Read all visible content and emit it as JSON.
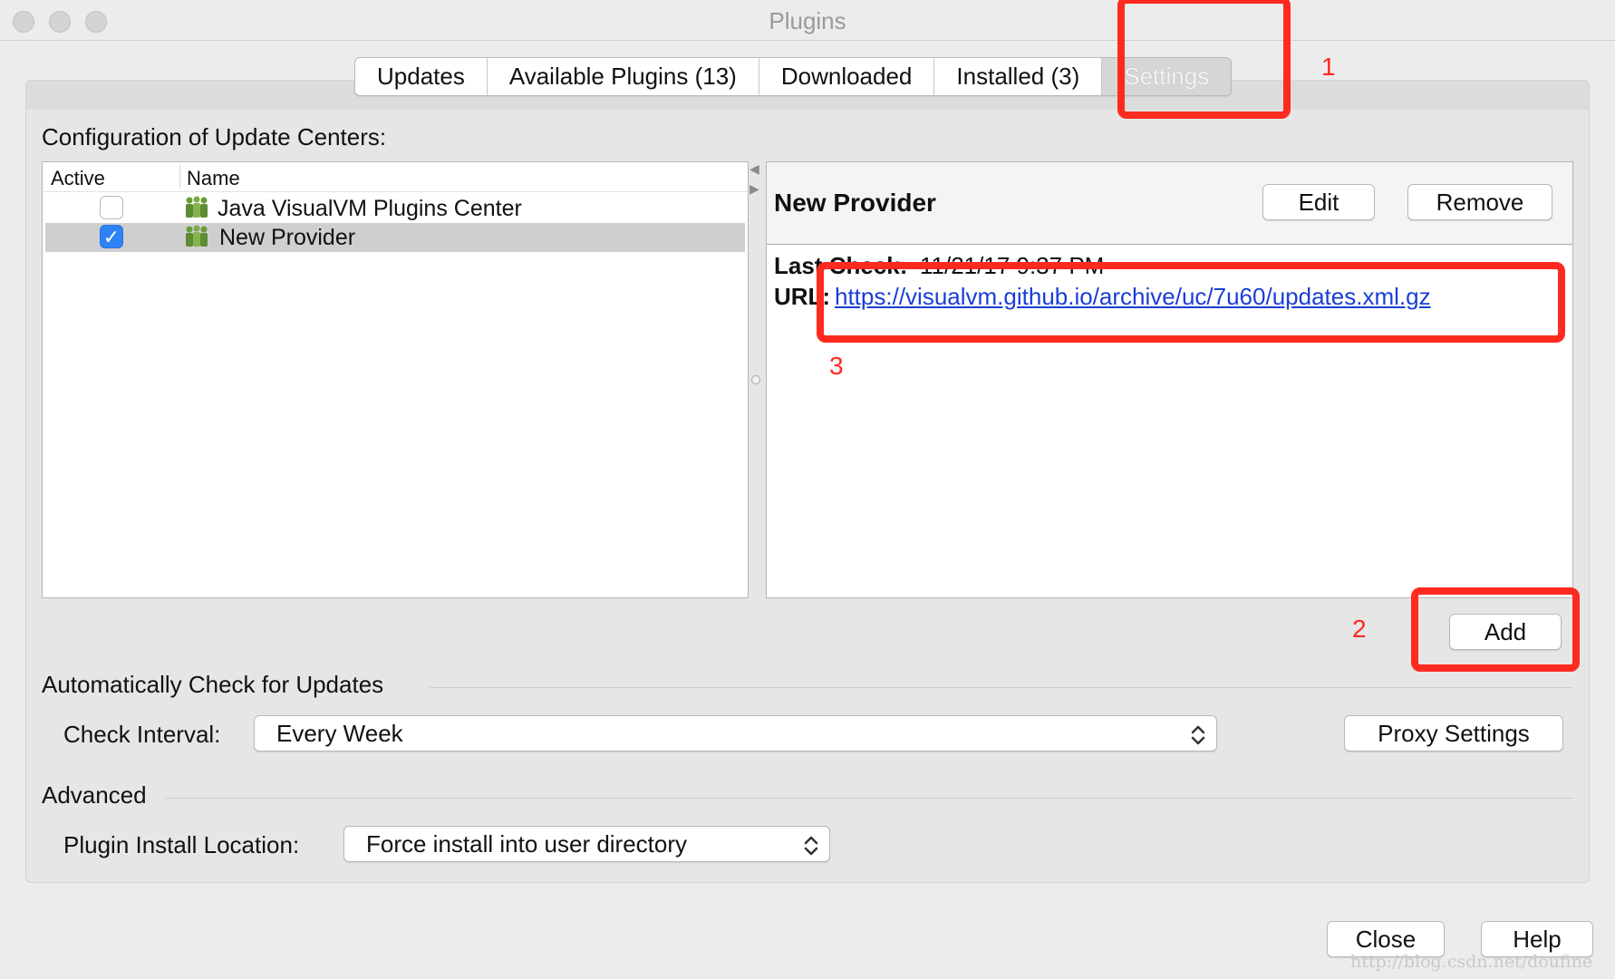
{
  "window": {
    "title": "Plugins"
  },
  "tabs": [
    {
      "label": "Updates"
    },
    {
      "label": "Available Plugins (13)"
    },
    {
      "label": "Downloaded"
    },
    {
      "label": "Installed (3)"
    },
    {
      "label": "Settings",
      "selected": true
    }
  ],
  "update_centers": {
    "label": "Configuration of Update Centers:",
    "columns": [
      "Active",
      "Name"
    ],
    "rows": [
      {
        "active": false,
        "name": "Java VisualVM Plugins Center",
        "selected": false
      },
      {
        "active": true,
        "name": "New Provider",
        "selected": true
      }
    ]
  },
  "details": {
    "title": "New Provider",
    "edit_label": "Edit",
    "remove_label": "Remove",
    "last_check_label": "Last Check:",
    "last_check_value": "11/21/17 9:37 PM",
    "url_label": "URL:",
    "url_value": "https://visualvm.github.io/archive/uc/7u60/updates.xml.gz"
  },
  "add_label": "Add",
  "auto_check": {
    "section_label": "Automatically Check for Updates",
    "interval_label": "Check Interval:",
    "interval_value": "Every Week",
    "proxy_label": "Proxy Settings"
  },
  "advanced": {
    "section_label": "Advanced",
    "location_label": "Plugin Install Location:",
    "location_value": "Force install into user directory"
  },
  "footer": {
    "close_label": "Close",
    "help_label": "Help"
  },
  "annotations": {
    "one": "1",
    "two": "2",
    "three": "3"
  },
  "watermark": "http://blog.csdn.net/doufine",
  "colors": {
    "annotation_red": "#ff2a1f",
    "checkbox_blue": "#2d83f4",
    "link_blue": "#1a3ed6"
  }
}
